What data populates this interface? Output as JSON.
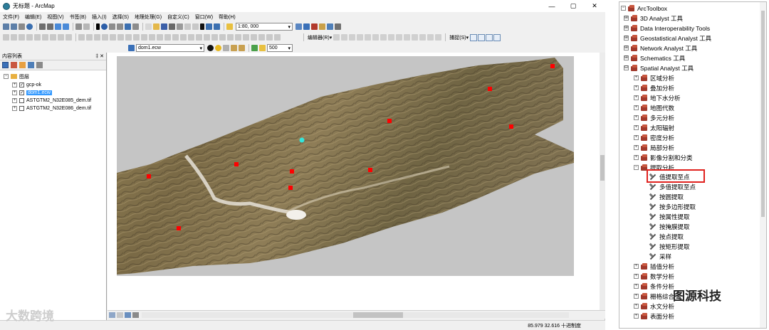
{
  "window": {
    "title": "无标题 - ArcMap",
    "controls": [
      "—",
      "▢",
      "✕"
    ]
  },
  "menu": [
    "文件(F)",
    "编辑(E)",
    "视图(V)",
    "书签(B)",
    "插入(I)",
    "选择(S)",
    "地理处理(G)",
    "自定义(C)",
    "窗口(W)",
    "帮助(H)"
  ],
  "toolbar": {
    "scale": "1:80, 000",
    "layer_select": "dom1.ecw",
    "resolution": "500",
    "editor_label": "编辑器(R)▾",
    "snap_label": "捕捉(S)▾"
  },
  "toc": {
    "title": "内容列表",
    "pin": "‡ ✕",
    "group": "图层",
    "layers": [
      {
        "name": "gcp-ok",
        "checked": "✓"
      },
      {
        "name": "dom1.ecw",
        "checked": "✓"
      },
      {
        "name": "ASTGTM2_N32E085_dem.tif",
        "checked": ""
      },
      {
        "name": "ASTGTM2_N32E086_dem.tif",
        "checked": ""
      }
    ]
  },
  "status": {
    "coords": "85.979  32.616 十进制度"
  },
  "colors": {
    "gcp_marker": "#ff0000",
    "highlight_point": "#33e6dc",
    "highlight_box": "#e0221e",
    "map_bg": "#c5c5c5"
  },
  "toolbox": {
    "root": "ArcToolbox",
    "items": [
      {
        "label": "3D Analyst 工具",
        "exp": "⊞"
      },
      {
        "label": "Data Interoperability Tools",
        "exp": "⊞"
      },
      {
        "label": "Geostatistical Analyst 工具",
        "exp": "⊞"
      },
      {
        "label": "Network Analyst 工具",
        "exp": "⊞"
      },
      {
        "label": "Schematics 工具",
        "exp": "⊞"
      },
      {
        "label": "Spatial Analyst 工具",
        "exp": "⊟"
      }
    ],
    "spatial": [
      "区域分析",
      "叠加分析",
      "地下水分析",
      "地图代数",
      "多元分析",
      "太阳辐射",
      "密度分析",
      "局部分析",
      "影像分割和分类"
    ],
    "extract": {
      "label": "提取分析",
      "tools": [
        "值提取至点",
        "多值提取至点",
        "按圆提取",
        "按多边形提取",
        "按属性提取",
        "按掩膜提取",
        "按点提取",
        "按矩形提取",
        "采样"
      ]
    },
    "after": [
      "插值分析",
      "数学分析",
      "条件分析",
      "栅格综合",
      "水文分析",
      "表面分析"
    ]
  },
  "watermarks": {
    "left": "大数跨境",
    "right": "图源科技"
  }
}
